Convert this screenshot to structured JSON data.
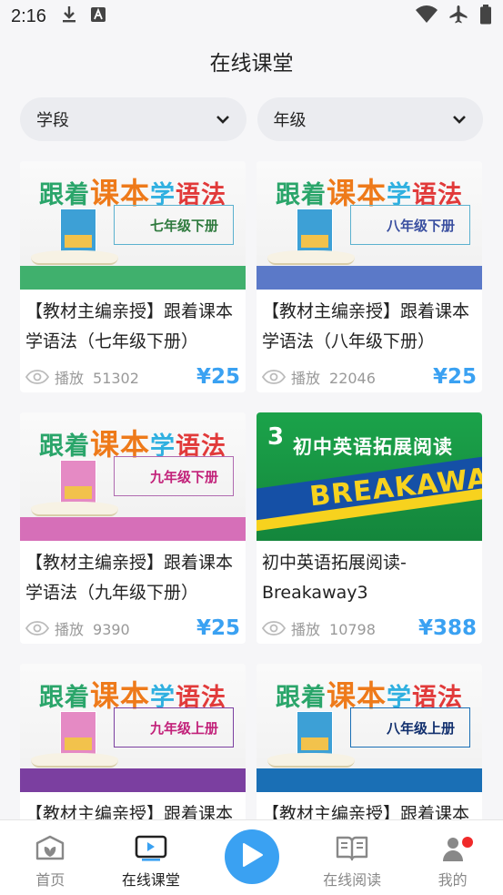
{
  "status_bar": {
    "time": "2:16"
  },
  "header": {
    "title": "在线课堂"
  },
  "filters": [
    {
      "label": "学段"
    },
    {
      "label": "年级"
    }
  ],
  "courses": [
    {
      "cover_type": "grammar",
      "cover_title": [
        "跟着",
        "课本",
        "学",
        "语法"
      ],
      "grade_tag": "七年级下册",
      "band": "#40b06d",
      "title": "【教材主编亲授】跟着课本学语法（七年级下册）",
      "plays_label": "播放",
      "plays": "51302",
      "price": "¥25"
    },
    {
      "cover_type": "grammar",
      "cover_title": [
        "跟着",
        "课本",
        "学",
        "语法"
      ],
      "grade_tag": "八年级下册",
      "band": "#5b79c8",
      "title": "【教材主编亲授】跟着课本学语法（八年级下册）",
      "plays_label": "播放",
      "plays": "22046",
      "price": "¥25"
    },
    {
      "cover_type": "grammar",
      "cover_title": [
        "跟着",
        "课本",
        "学",
        "语法"
      ],
      "grade_tag": "九年级下册",
      "band": "#d66fb8",
      "title": "【教材主编亲授】跟着课本学语法（九年级下册）",
      "plays_label": "播放",
      "plays": "9390",
      "price": "¥25"
    },
    {
      "cover_type": "breakaway",
      "cover_num": "3",
      "cover_title_text": "初中英语拓展阅读",
      "cover_word": "BREAKAWAY",
      "title": "初中英语拓展阅读-Breakaway3",
      "plays_label": "播放",
      "plays": "10798",
      "price": "¥388"
    },
    {
      "cover_type": "grammar",
      "cover_title": [
        "跟着",
        "课本",
        "学",
        "语法"
      ],
      "grade_tag": "九年级上册",
      "band": "#7b3fa0",
      "title": "【教材主编亲授】跟着课本学语法（九年级上册）",
      "plays_label": "播放",
      "plays": "",
      "price": ""
    },
    {
      "cover_type": "grammar",
      "cover_title": [
        "跟着",
        "课本",
        "学",
        "语法"
      ],
      "grade_tag": "八年级上册",
      "band": "#1a6fb5",
      "title": "【教材主编亲授】跟着课本学语法（八年级上册）",
      "plays_label": "播放",
      "plays": "",
      "price": ""
    }
  ],
  "tabs": [
    {
      "label": "首页",
      "icon": "home-leaf-icon",
      "active": false
    },
    {
      "label": "在线课堂",
      "icon": "video-class-icon",
      "active": true
    },
    {
      "label": "",
      "icon": "play-icon",
      "active": false
    },
    {
      "label": "在线阅读",
      "icon": "open-book-icon",
      "active": false
    },
    {
      "label": "我的",
      "icon": "profile-icon",
      "active": false
    }
  ],
  "colors": {
    "accent": "#3aa1f2",
    "badge": "#f02a2a",
    "price": "#3aa1f2"
  }
}
